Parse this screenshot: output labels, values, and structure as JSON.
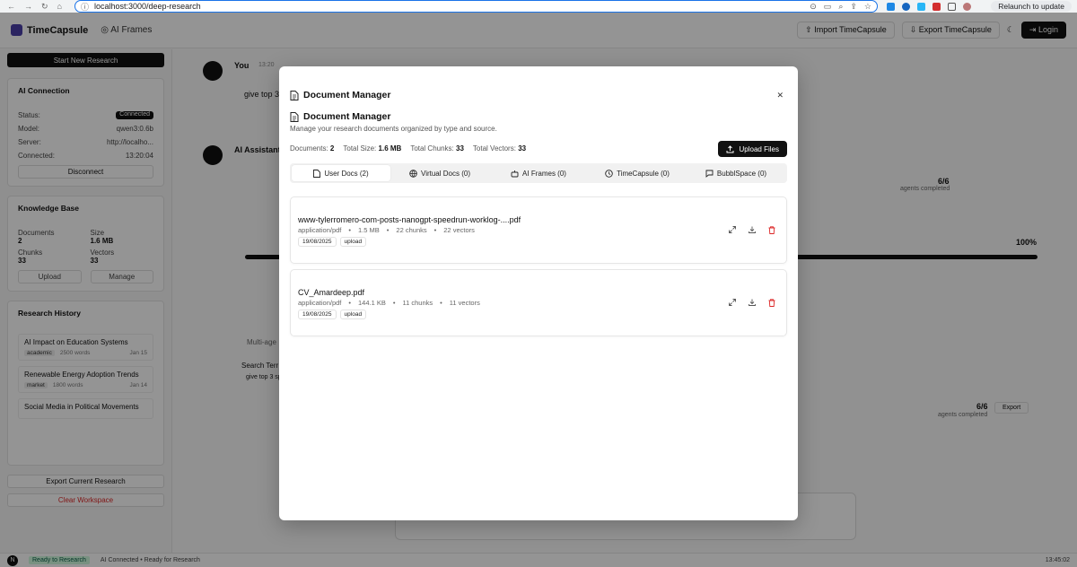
{
  "browser": {
    "url": "localhost:3000/deep-research",
    "relaunch": "Relaunch to update"
  },
  "app": {
    "brand": "TimeCapsule",
    "ai_frames": "AI Frames",
    "import": "Import TimeCapsule",
    "export": "Export TimeCapsule",
    "login": "Login"
  },
  "sidebar": {
    "new_research": "Start New Research",
    "ai_connection": {
      "title": "AI Connection",
      "status_label": "Status:",
      "status_value": "Connected",
      "model_label": "Model:",
      "model_value": "qwen3:0.6b",
      "server_label": "Server:",
      "server_value": "http://localho...",
      "connected_label": "Connected:",
      "connected_value": "13:20:04",
      "disconnect": "Disconnect"
    },
    "knowledge_base": {
      "title": "Knowledge Base",
      "documents_label": "Documents",
      "documents_value": "2",
      "size_label": "Size",
      "size_value": "1.6 MB",
      "chunks_label": "Chunks",
      "chunks_value": "33",
      "vectors_label": "Vectors",
      "vectors_value": "33",
      "upload": "Upload",
      "manage": "Manage"
    },
    "history": {
      "title": "Research History",
      "items": [
        {
          "title": "AI Impact on Education Systems",
          "tag": "academic",
          "words": "2500 words",
          "date": "Jan 15"
        },
        {
          "title": "Renewable Energy Adoption Trends",
          "tag": "market",
          "words": "1800 words",
          "date": "Jan 14"
        },
        {
          "title": "Social Media in Political Movements",
          "tag": "",
          "words": "",
          "date": ""
        }
      ]
    },
    "export_current": "Export Current Research",
    "clear": "Clear Workspace"
  },
  "main": {
    "you": "You",
    "you_time": "13:20",
    "query": "give top 3",
    "assistant": "AI Assistant",
    "agents1": "6/6",
    "agents_completed": "agents completed",
    "percent": "100%",
    "agents2": "6/6",
    "export": "Export",
    "multi": "Multi-age",
    "search_terms": "Search Terr",
    "search_query": "give top 3 sp"
  },
  "status": {
    "ready": "Ready to Research",
    "ai": "AI Connected • Ready for Research",
    "time": "13:45:02"
  },
  "modal": {
    "title": "Document Manager",
    "heading": "Document Manager",
    "description": "Manage your research documents organized by type and source.",
    "stats": {
      "documents_label": "Documents:",
      "documents": "2",
      "size_label": "Total Size:",
      "size": "1.6 MB",
      "chunks_label": "Total Chunks:",
      "chunks": "33",
      "vectors_label": "Total Vectors:",
      "vectors": "33"
    },
    "upload_files": "Upload Files",
    "tabs": [
      {
        "label": "User Docs (2)",
        "icon": "file-icon"
      },
      {
        "label": "Virtual Docs (0)",
        "icon": "globe-icon"
      },
      {
        "label": "AI Frames (0)",
        "icon": "frames-icon"
      },
      {
        "label": "TimeCapsule (0)",
        "icon": "clock-icon"
      },
      {
        "label": "BubblSpace (0)",
        "icon": "chat-icon"
      }
    ],
    "documents": [
      {
        "name": "www-tylerromero-com-posts-nanogpt-speedrun-worklog-....pdf",
        "type": "application/pdf",
        "size": "1.5 MB",
        "chunks": "22 chunks",
        "vectors": "22 vectors",
        "date": "19/08/2025",
        "source": "upload"
      },
      {
        "name": "CV_Amardeep.pdf",
        "type": "application/pdf",
        "size": "144.1 KB",
        "chunks": "11 chunks",
        "vectors": "11 vectors",
        "date": "19/08/2025",
        "source": "upload"
      }
    ]
  }
}
